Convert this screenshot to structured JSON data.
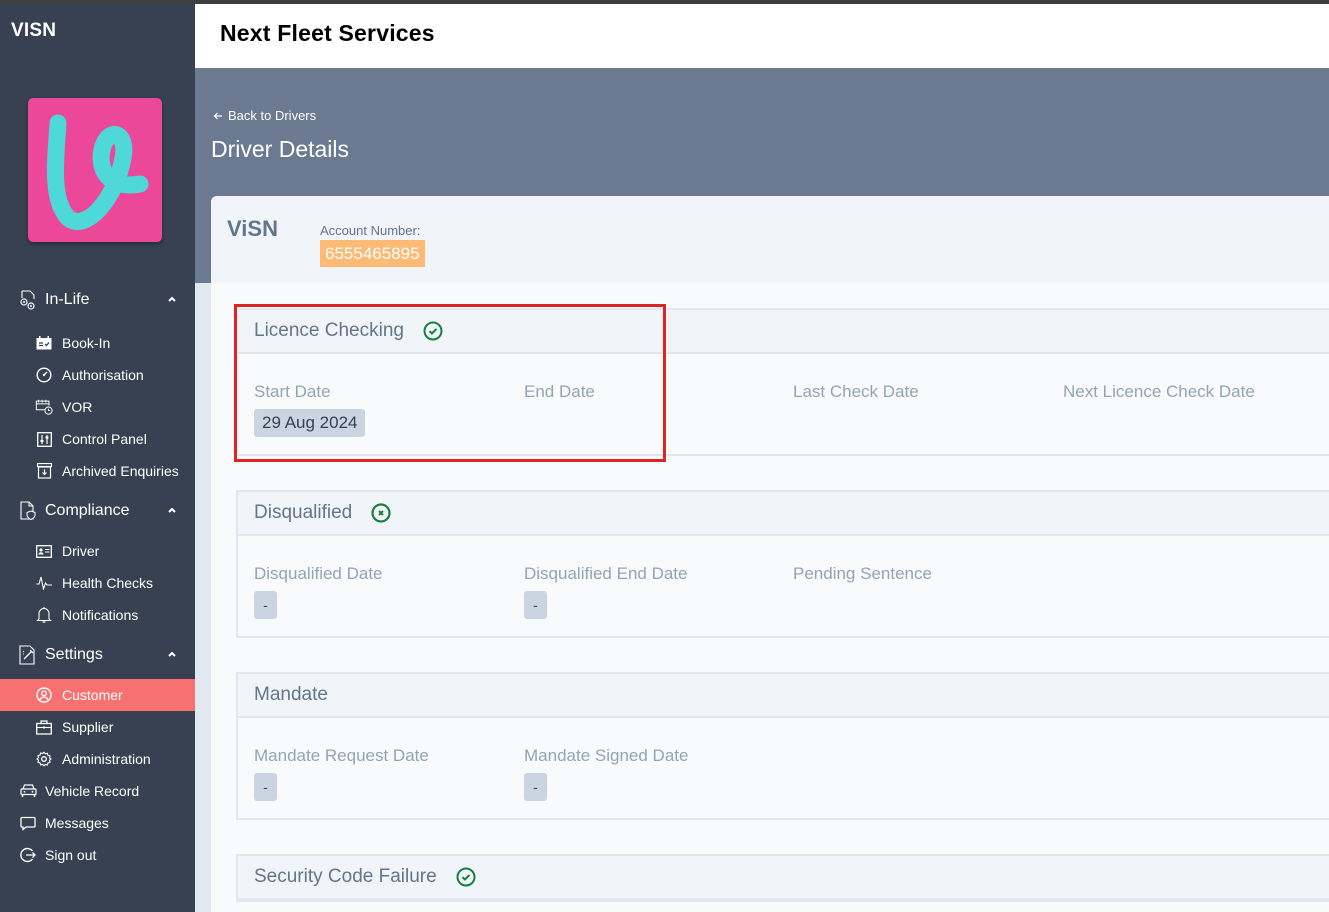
{
  "sidebar": {
    "brand": "VISN",
    "logo_alt": "V logo",
    "groups": [
      {
        "label": "In-Life",
        "icon": "gears-document-icon",
        "expanded": true,
        "items": [
          {
            "label": "Book-In",
            "icon": "calendar-check-icon"
          },
          {
            "label": "Authorisation",
            "icon": "gauge-icon"
          },
          {
            "label": "VOR",
            "icon": "calendar-clock-icon"
          },
          {
            "label": "Control Panel",
            "icon": "sliders-icon"
          },
          {
            "label": "Archived Enquiries",
            "icon": "archive-icon"
          }
        ]
      },
      {
        "label": "Compliance",
        "icon": "document-shield-icon",
        "expanded": true,
        "items": [
          {
            "label": "Driver",
            "icon": "id-card-icon"
          },
          {
            "label": "Health Checks",
            "icon": "pulse-icon"
          },
          {
            "label": "Notifications",
            "icon": "bell-icon"
          }
        ]
      },
      {
        "label": "Settings",
        "icon": "document-tools-icon",
        "expanded": true,
        "items": [
          {
            "label": "Customer",
            "icon": "user-circle-icon",
            "active": true
          },
          {
            "label": "Supplier",
            "icon": "briefcase-icon"
          },
          {
            "label": "Administration",
            "icon": "gear-icon"
          }
        ]
      }
    ],
    "links": [
      {
        "label": "Vehicle Record",
        "icon": "car-icon"
      },
      {
        "label": "Messages",
        "icon": "message-icon"
      },
      {
        "label": "Sign out",
        "icon": "sign-out-icon"
      }
    ],
    "active_color": "#f87171"
  },
  "header": {
    "title": "Next Fleet Services"
  },
  "banner": {
    "back_label": "Back to Drivers",
    "page_title": "Driver Details"
  },
  "account": {
    "name": "ViSN",
    "number_label": "Account Number:",
    "number": "6555465895"
  },
  "sections": [
    {
      "title": "Licence Checking",
      "status": "check",
      "status_color": "#15803d",
      "fields": [
        {
          "label": "Start Date",
          "value": "29 Aug 2024"
        },
        {
          "label": "End Date",
          "value": null
        },
        {
          "label": "Last Check Date",
          "value": null
        },
        {
          "label": "Next Licence Check Date",
          "value": null
        }
      ]
    },
    {
      "title": "Disqualified",
      "status": "cross",
      "status_color": "#15803d",
      "fields": [
        {
          "label": "Disqualified Date",
          "value": "-"
        },
        {
          "label": "Disqualified End Date",
          "value": "-"
        },
        {
          "label": "Pending Sentence",
          "value": null
        }
      ]
    },
    {
      "title": "Mandate",
      "status": null,
      "fields": [
        {
          "label": "Mandate Request Date",
          "value": "-"
        },
        {
          "label": "Mandate Signed Date",
          "value": "-"
        }
      ]
    },
    {
      "title": "Security Code Failure",
      "status": "check",
      "status_color": "#15803d",
      "fields": []
    }
  ],
  "annotation": {
    "highlight_color": "#dc2626",
    "target": "Licence Checking"
  }
}
